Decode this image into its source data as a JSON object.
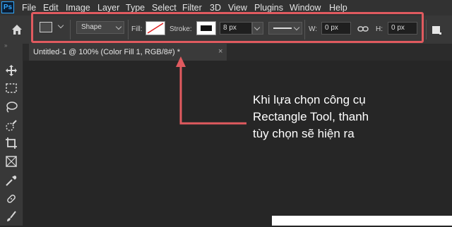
{
  "app": {
    "logo": "Ps"
  },
  "menu": [
    "File",
    "Edit",
    "Image",
    "Layer",
    "Type",
    "Select",
    "Filter",
    "3D",
    "View",
    "Plugins",
    "Window",
    "Help"
  ],
  "options": {
    "mode": "Shape",
    "fill_label": "Fill:",
    "stroke_label": "Stroke:",
    "stroke_width": "8 px",
    "w_label": "W:",
    "w_value": "0 px",
    "h_label": "H:",
    "h_value": "0 px"
  },
  "document": {
    "tab_title": "Untitled-1 @ 100% (Color Fill 1, RGB/8#) *",
    "close": "×"
  },
  "annotation": {
    "lines": [
      "Khi lựa chọn công cụ",
      "Rectangle Tool, thanh",
      "tùy chọn sẽ hiện ra"
    ]
  },
  "colors": {
    "highlight": "#e05a5f",
    "accent": "#31a8ff"
  },
  "icons": [
    "home-icon",
    "move-icon",
    "marquee-icon",
    "lasso-icon",
    "quick-select-icon",
    "crop-icon",
    "frame-icon",
    "eyedropper-icon",
    "healing-brush-icon",
    "brush-icon"
  ]
}
